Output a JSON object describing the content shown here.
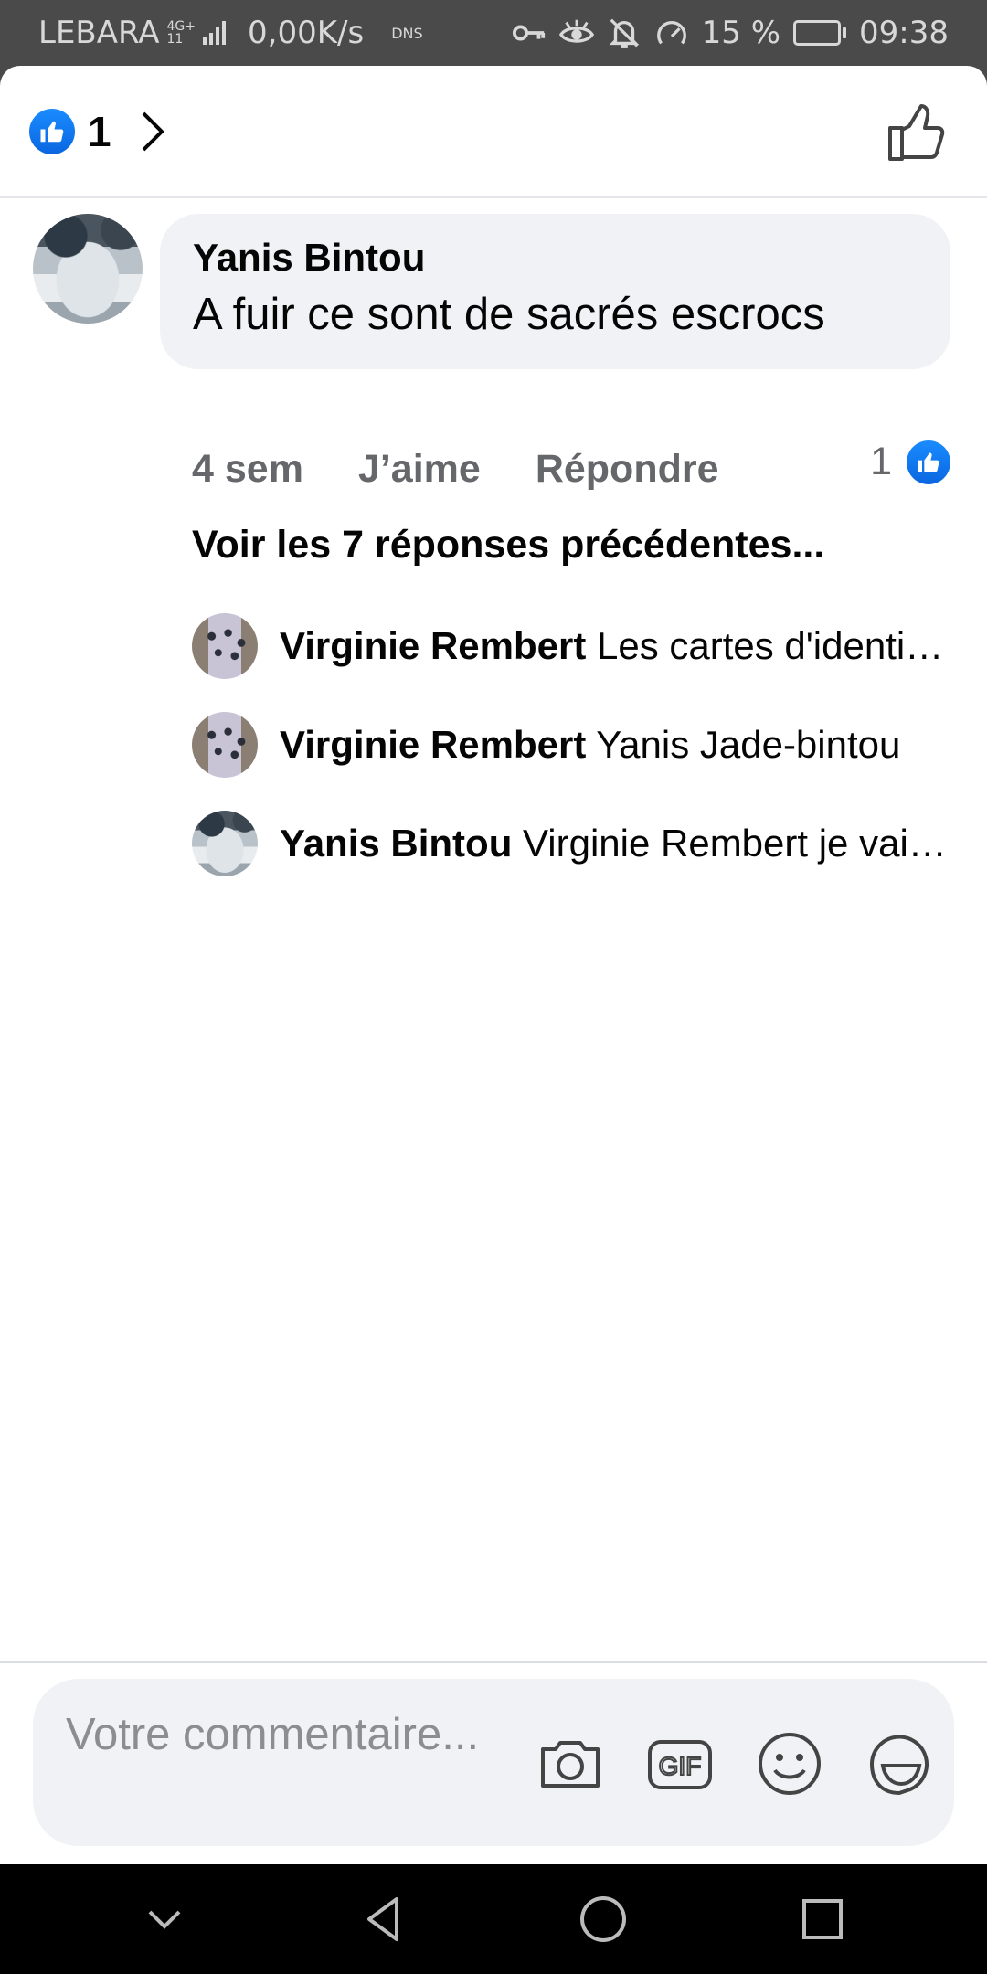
{
  "status_bar": {
    "carrier": "LEBARA",
    "network_top": "4G+",
    "network_bottom": "11",
    "speed": "0,00K/s",
    "dns": "DNS",
    "battery_percent": "15 %",
    "battery_level": 0.15,
    "time": "09:38",
    "icons": [
      "key-icon",
      "eye-icon",
      "bell-off-icon",
      "speedometer-icon",
      "battery-icon"
    ]
  },
  "header": {
    "reaction_icon": "like-icon",
    "reaction_count": "1",
    "chevron_icon": "chevron-right-icon",
    "like_button_icon": "thumbs-up-outline-icon"
  },
  "comment": {
    "author": "Yanis Bintou",
    "text": "A fuir ce sont de sacrés escrocs",
    "time": "4 sem",
    "like_label": "J’aime",
    "reply_label": "Répondre",
    "like_count": "1",
    "see_previous": "Voir les 7 réponses précédentes..."
  },
  "replies": [
    {
      "author": "Virginie Rembert",
      "text": "Les cartes d'identité sont bien arrivées",
      "avatar": "room"
    },
    {
      "author": "Virginie Rembert",
      "text": "Yanis Jade-bintou",
      "avatar": "room"
    },
    {
      "author": "Yanis Bintou",
      "text": "Virginie Rembert je vais voir",
      "avatar": "snow"
    }
  ],
  "composer": {
    "placeholder": "Votre commentaire...",
    "icons": [
      "camera-icon",
      "gif-icon",
      "emoji-icon",
      "sticker-icon"
    ],
    "gif_label": "GIF"
  },
  "nav_bar": {
    "icons": [
      "chevron-down-icon",
      "back-icon",
      "home-icon",
      "recents-icon"
    ]
  }
}
